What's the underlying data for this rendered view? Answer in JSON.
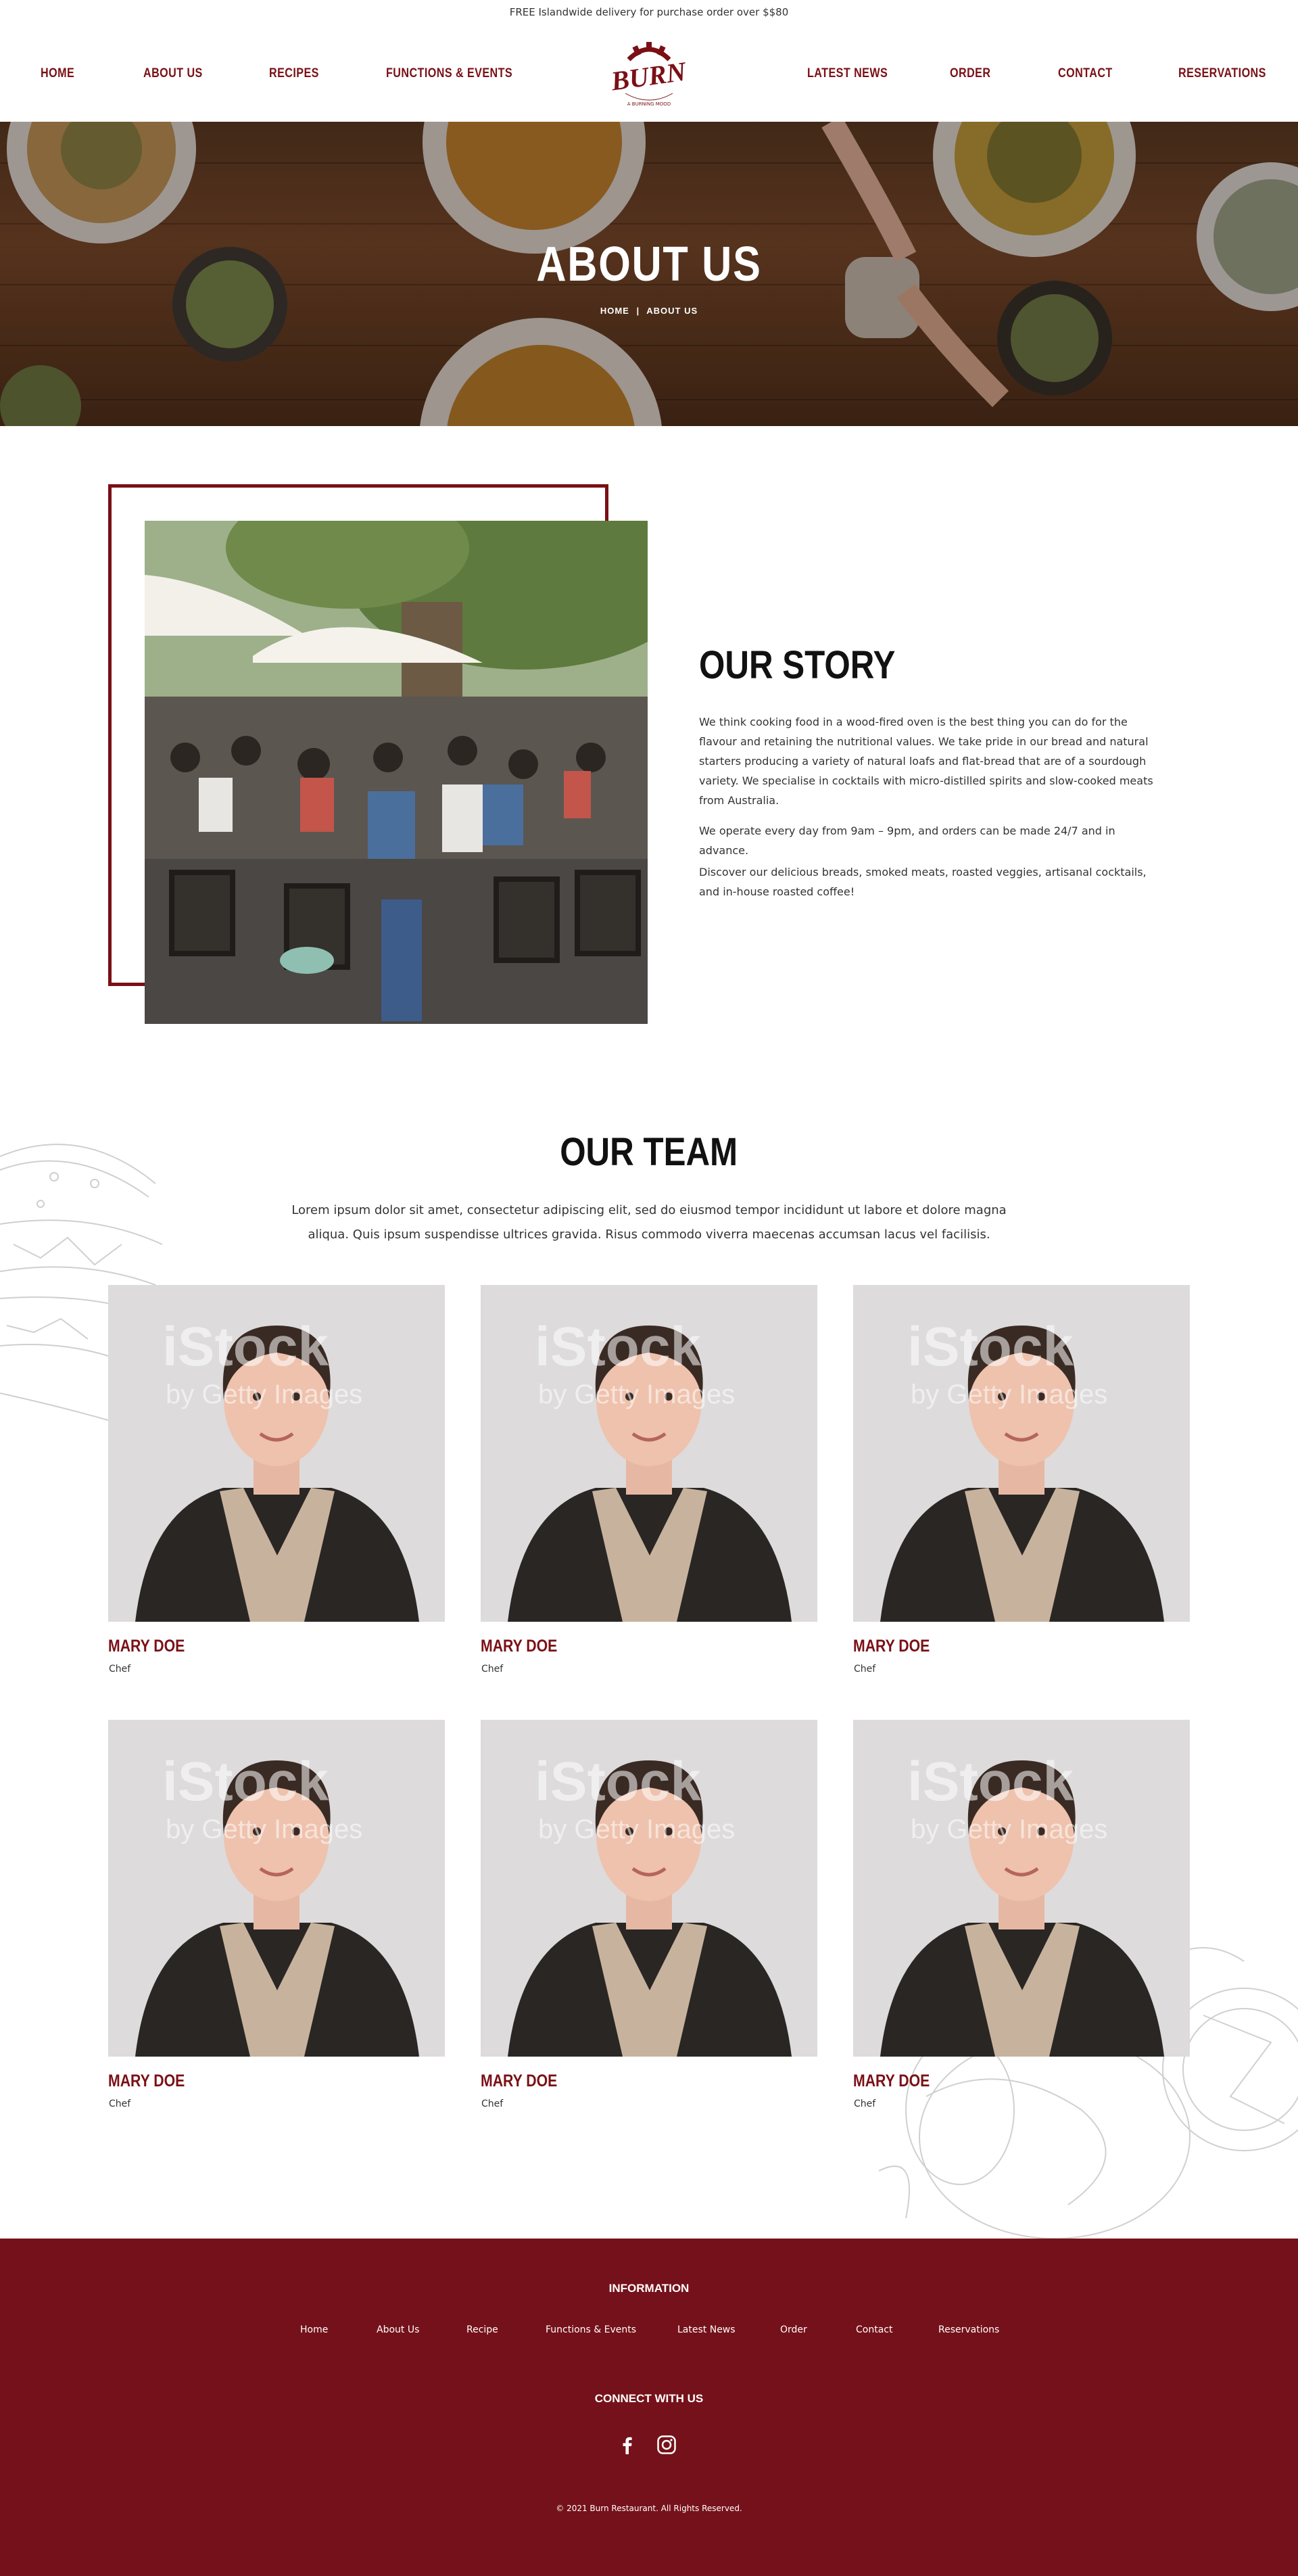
{
  "topbar": {
    "text": "FREE Islandwide delivery for purchase order over $$80"
  },
  "nav": {
    "left": [
      "HOME",
      "ABOUT US",
      "RECIPES",
      "FUNCTIONS & EVENTS"
    ],
    "right": [
      "LATEST NEWS",
      "ORDER",
      "CONTACT",
      "RESERVATIONS"
    ]
  },
  "logo": {
    "name": "BURN",
    "tagline": "A BURNING MOOD"
  },
  "hero": {
    "title": "ABOUT US",
    "breadcrumb": [
      "HOME",
      "|",
      "ABOUT US"
    ]
  },
  "story": {
    "title": "OUR STORY",
    "paragraphs": [
      "We think cooking food in a wood-fired oven is the best thing you can do for the flavour and retaining the nutritional values. We take pride in our bread and natural starters producing a variety of natural loafs and flat-bread that are of a sourdough variety. We specialise in cocktails with micro-distilled spirits and slow-cooked meats from Australia.",
      "We operate every day from 9am – 9pm, and  orders can be made 24/7 and in advance.",
      "Discover our delicious breads, smoked meats, roasted veggies, artisanal cocktails, and in-house roasted coffee!"
    ]
  },
  "team": {
    "title": "OUR TEAM",
    "description": "Lorem ipsum dolor sit amet, consectetur adipiscing elit, sed do eiusmod tempor incididunt ut labore et dolore magna aliqua. Quis ipsum suspendisse ultrices gravida. Risus commodo viverra maecenas accumsan lacus vel facilisis.",
    "members": [
      {
        "name": "MARY DOE",
        "role": "Chef"
      },
      {
        "name": "MARY DOE",
        "role": "Chef"
      },
      {
        "name": "MARY DOE",
        "role": "Chef"
      },
      {
        "name": "MARY DOE",
        "role": "Chef"
      },
      {
        "name": "MARY DOE",
        "role": "Chef"
      },
      {
        "name": "MARY DOE",
        "role": "Chef"
      }
    ],
    "watermark": {
      "brand": "iStock",
      "sub": "by Getty Images"
    }
  },
  "footer": {
    "info_heading": "INFORMATION",
    "links": [
      "Home",
      "About Us",
      "Recipe",
      "Functions & Events",
      "Latest News",
      "Order",
      "Contact",
      "Reservations"
    ],
    "connect_heading": "CONNECT WITH US",
    "social_icons": [
      "facebook-icon",
      "instagram-icon"
    ],
    "copyright": "© 2021 Burn Restaurant. All Rights Reserved."
  },
  "colors": {
    "brand": "#7a1016",
    "footer_bg": "#75111a",
    "text": "#333333"
  }
}
